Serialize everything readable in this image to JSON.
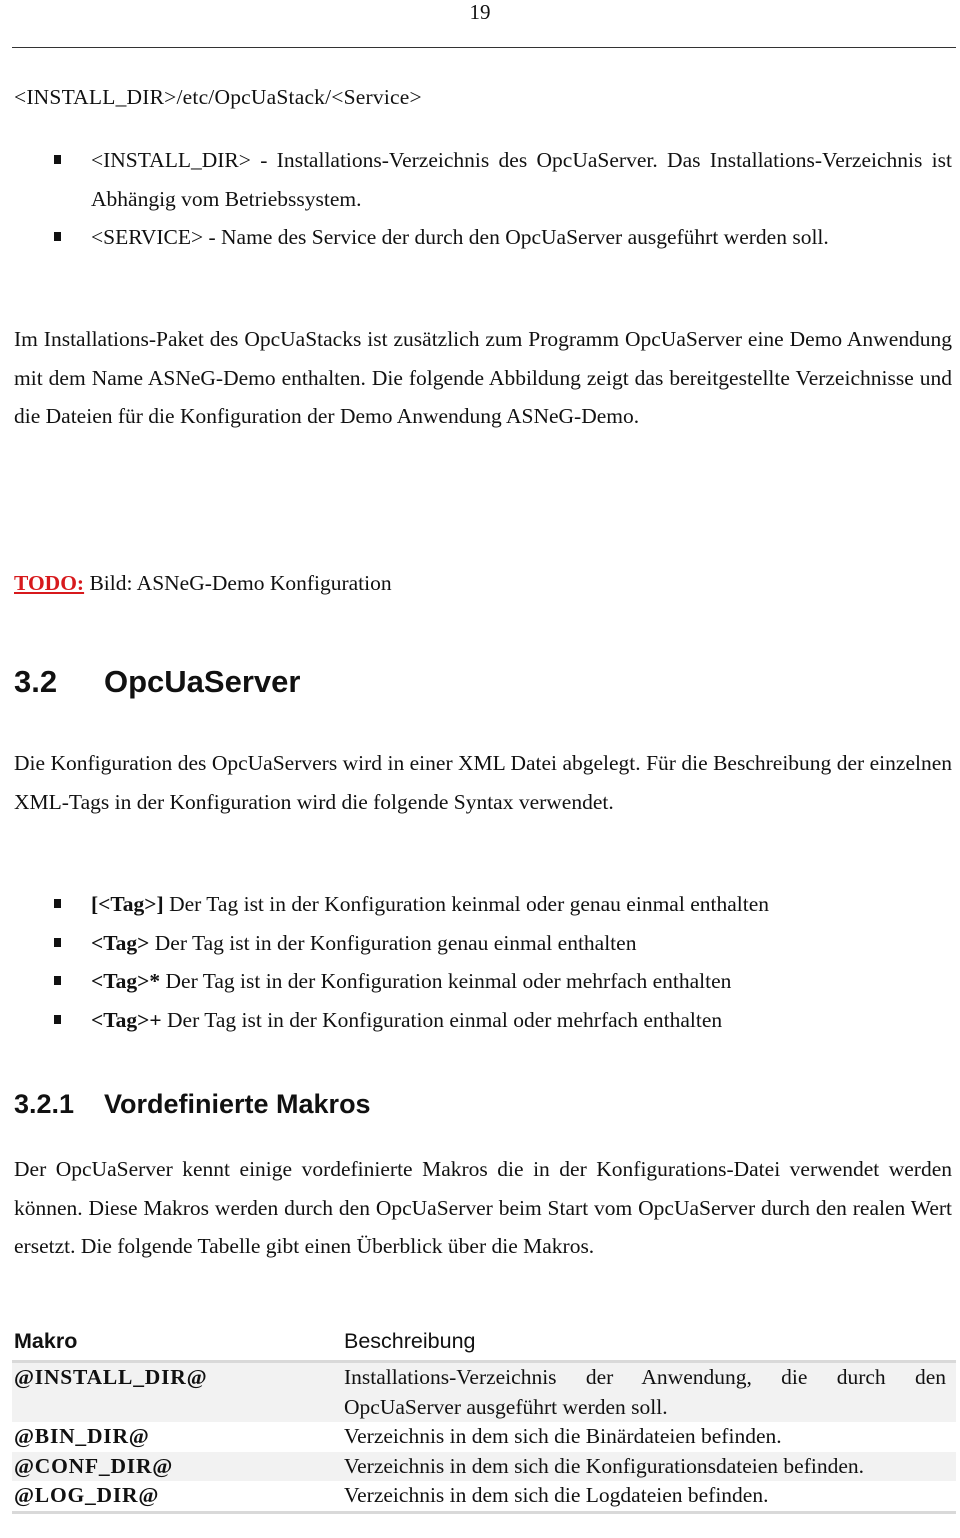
{
  "page": {
    "number": "19"
  },
  "path_line": "<INSTALL_DIR>/etc/OpcUaStack/<Service>",
  "placeholders_list": [
    {
      "text": "<INSTALL_DIR> - Installations-Verzeichnis des OpcUaServer. Das Installations-Verzeichnis ist Abhängig vom Betriebssystem."
    },
    {
      "text": "<SERVICE> - Name des Service der durch den OpcUaServer ausgeführt werden soll."
    }
  ],
  "intro_paragraph": "Im Installations-Paket des OpcUaStacks  ist zusätzlich zum Programm OpcUaServer eine Demo Anwendung mit dem Name ASNeG-Demo enthalten. Die folgende Abbildung zeigt das bereitgestellte Verzeichnisse und die Dateien für die Konfiguration der Demo Anwendung ASNeG-Demo.",
  "todo": {
    "label": "TODO:",
    "text": " Bild: ASNeG-Demo Konfiguration",
    "color": "#d7191c"
  },
  "section": {
    "number": "3.2",
    "title": "OpcUaServer"
  },
  "section_paragraph": "Die Konfiguration des OpcUaServers wird in einer XML Datei abgelegt. Für die Beschreibung der einzelnen XML-Tags in der Konfiguration wird die folgende Syntax verwendet.",
  "syntax_list": [
    {
      "tag": "[<Tag>]",
      "text": " Der Tag ist in der Konfiguration keinmal oder genau einmal enthalten"
    },
    {
      "tag": "<Tag>",
      "text": " Der Tag ist in der Konfiguration genau einmal enthalten"
    },
    {
      "tag": "<Tag>*",
      "text": " Der Tag ist in der Konfiguration keinmal oder mehrfach enthalten"
    },
    {
      "tag": "<Tag>+",
      "text": " Der Tag ist in der Konfiguration einmal oder mehrfach enthalten"
    }
  ],
  "subsection": {
    "number": "3.2.1",
    "title": "Vordefinierte Makros"
  },
  "subsection_paragraph": "Der OpcUaServer kennt einige vordefinierte Makros die in der Konfigurations-Datei verwendet werden können. Diese Makros werden durch den OpcUaServer beim Start vom OpcUaServer durch den realen Wert ersetzt. Die folgende Tabelle gibt einen Überblick über die Makros.",
  "macro_table": {
    "headers": [
      "Makro",
      "Beschreibung"
    ],
    "rows": [
      {
        "macro": "@INSTALL_DIR@",
        "description": "Installations-Verzeichnis der Anwendung, die durch den OpcUaServer ausgeführt werden soll."
      },
      {
        "macro": "@BIN_DIR@",
        "description": "Verzeichnis in dem sich die Binärdateien befinden."
      },
      {
        "macro": "@CONF_DIR@",
        "description": "Verzeichnis in dem sich die Konfigurationsdateien befinden."
      },
      {
        "macro": "@LOG_DIR@",
        "description": "Verzeichnis in dem sich die Logdateien befinden."
      }
    ]
  }
}
